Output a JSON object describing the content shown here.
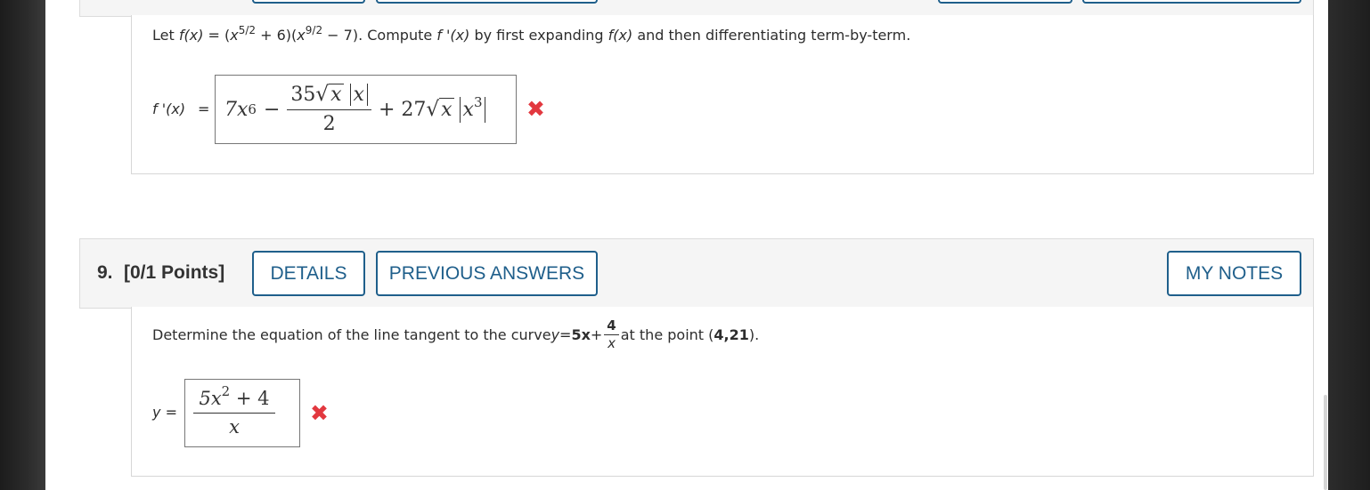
{
  "prev_question": {
    "prompt": {
      "lead": "Let ",
      "fx": "f(x)",
      "eq": " = (",
      "x1": "x",
      "exp1": "5/2",
      "mid1": " + 6)(",
      "x2": "x",
      "exp2": "9/2",
      "mid2": " − 7). Compute ",
      "fpx": "f '(x)",
      "mid3": " by first expanding ",
      "fx2": "f(x)",
      "tail": " and then differentiating term-by-term."
    },
    "answer_label": "f '(x)",
    "answer_eq": "=",
    "answer": {
      "t1": "7x",
      "t1_exp": "6",
      "minus": "−",
      "num_coef": "35",
      "num_rad": "x",
      "num_abs": "x",
      "den": "2",
      "plus": "+ 27",
      "rad2": "x",
      "abs2": "x",
      "abs2_exp": "3"
    },
    "result_icon": "incorrect-x-icon",
    "result_symbol": "✖"
  },
  "question": {
    "number": "9.",
    "points": "[0/1 Points]",
    "buttons": {
      "details": "DETAILS",
      "previous_answers": "PREVIOUS ANSWERS",
      "my_notes": "MY NOTES"
    },
    "prompt": {
      "lead": "Determine the equation of the line tangent to the curve ",
      "y": "y",
      "eq": " = ",
      "coef": "5x",
      "plus": " + ",
      "frac_num": "4",
      "frac_den": "x",
      "mid": " at the point (",
      "point": "4,21",
      "tail": ")."
    },
    "answer_label": "y",
    "answer_eq": "=",
    "answer": {
      "num_coef": "5x",
      "num_exp": "2",
      "num_tail": " + 4",
      "den": "x"
    },
    "result_icon": "incorrect-x-icon",
    "result_symbol": "✖"
  },
  "colors": {
    "accent": "#1f5f8b",
    "incorrect": "#e2383f",
    "header_bg": "#f5f5f5"
  }
}
